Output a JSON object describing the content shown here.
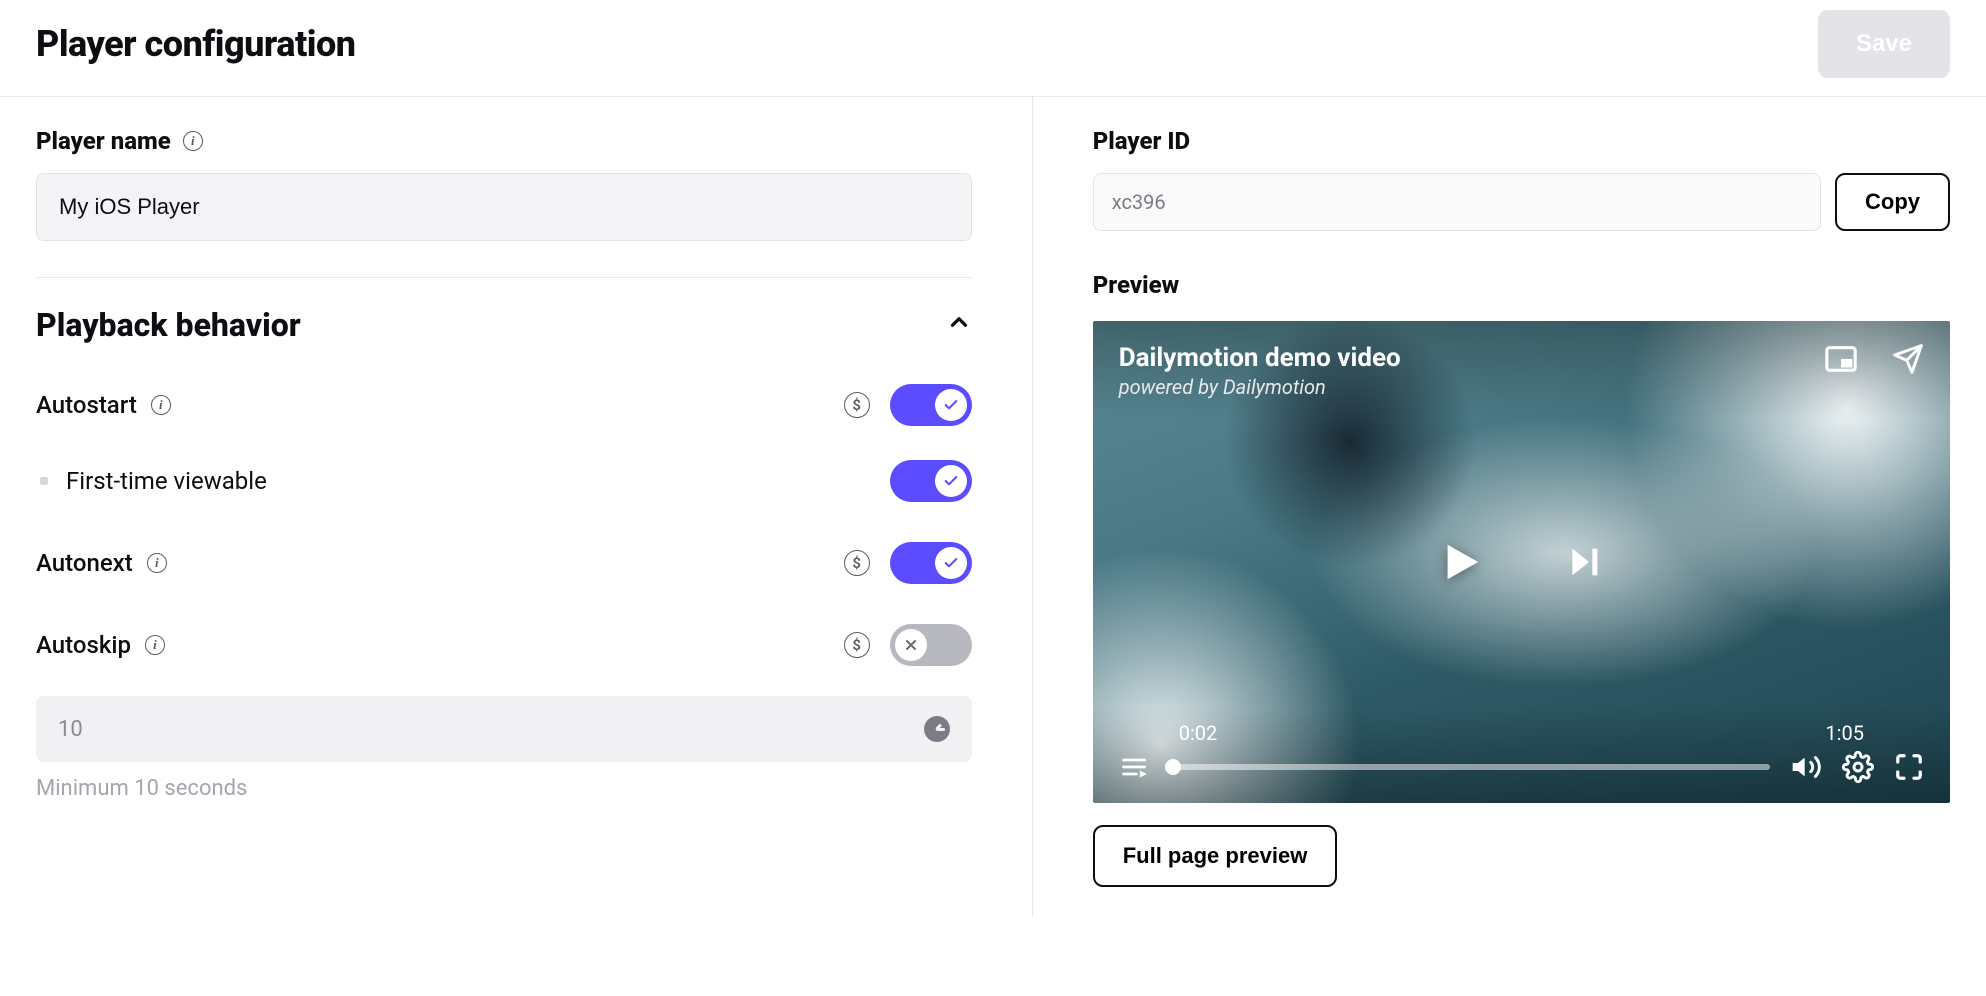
{
  "header": {
    "title": "Player configuration",
    "save_label": "Save"
  },
  "left": {
    "player_name_label": "Player name",
    "player_name_value": "My iOS Player",
    "playback": {
      "title": "Playback behavior",
      "autostart_label": "Autostart",
      "firsttime_label": "First-time viewable",
      "autonext_label": "Autonext",
      "autoskip_label": "Autoskip",
      "autoskip_value": "10",
      "autoskip_hint": "Minimum 10 seconds"
    }
  },
  "right": {
    "player_id_label": "Player ID",
    "player_id_value": "xc396",
    "copy_label": "Copy",
    "preview_label": "Preview",
    "video_title": "Dailymotion demo video",
    "video_sub": "powered by Dailymotion",
    "time_current": "0:02",
    "time_total": "1:05",
    "fullpage_label": "Full page preview"
  }
}
